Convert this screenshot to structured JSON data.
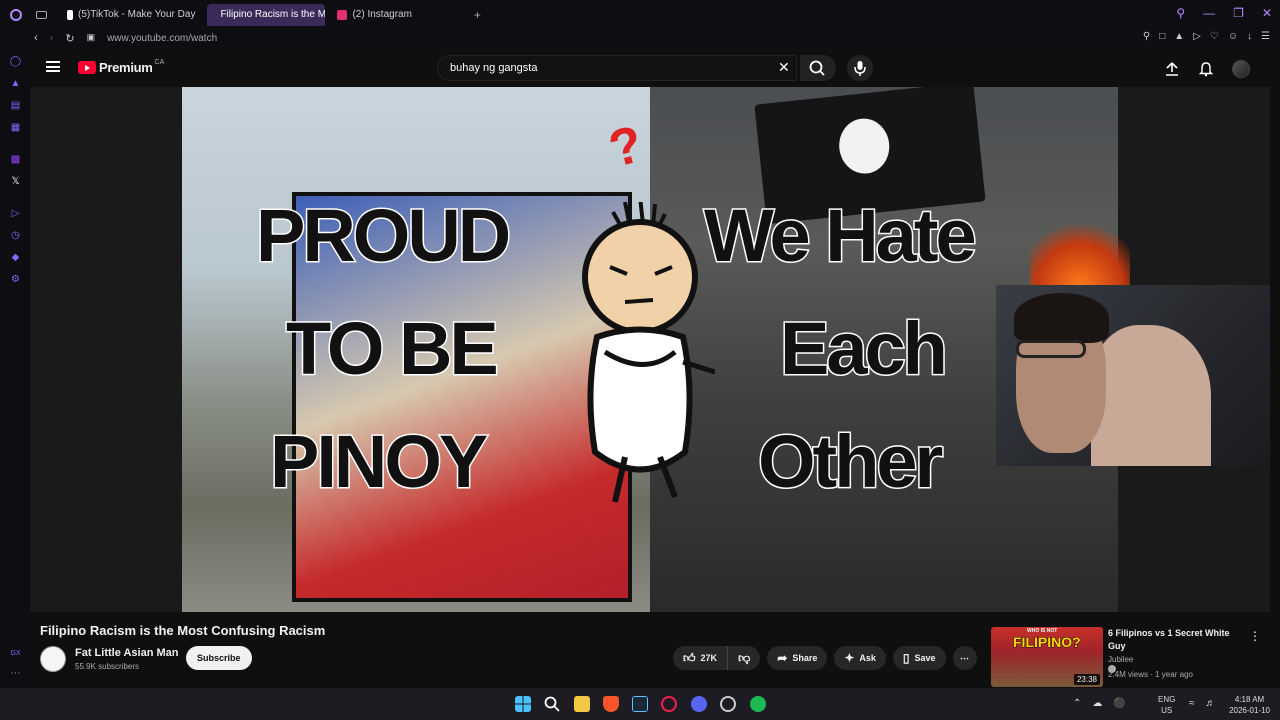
{
  "browser": {
    "tabs": [
      {
        "label": "(5)TikTok - Make Your Day",
        "color": "#ffffff"
      },
      {
        "label": "Filipino Racism is the Most",
        "color": "#ff0033"
      },
      {
        "label": "(2) Instagram",
        "color": "#e1306c"
      }
    ],
    "new_tab": "+",
    "url": "www.youtube.com/watch"
  },
  "youtube": {
    "logo_text": "Premium",
    "region": "CA",
    "search_value": "buhay ng gangsta"
  },
  "thumbnail": {
    "line1_left": "PROUD",
    "line2_left": "TO BE",
    "line3_left": "PINOY",
    "line1_right": "We Hate",
    "line2_right": "Each",
    "line3_right": "Other",
    "question_mark": "?"
  },
  "video": {
    "title": "Filipino Racism is the Most Confusing Racism",
    "channel": "Fat Little Asian Man",
    "subscribers": "55.9K subscribers",
    "subscribe_label": "Subscribe",
    "likes": "27K",
    "share_label": "Share",
    "ask_label": "Ask",
    "save_label": "Save"
  },
  "recommendation": {
    "thumb_top": "WHO IS NOT",
    "thumb_main": "FILIPINO?",
    "duration": "23:38",
    "title": "6 Filipinos vs 1 Secret White Guy",
    "channel": "Jubilee",
    "meta": "2.4M views · 1 year ago"
  },
  "taskbar": {
    "lang_1": "ENG",
    "lang_2": "US",
    "time": "4:18 AM",
    "date": "2026-01-10"
  },
  "colors": {
    "accent": "#b38cff",
    "youtube_red": "#ff0033"
  }
}
